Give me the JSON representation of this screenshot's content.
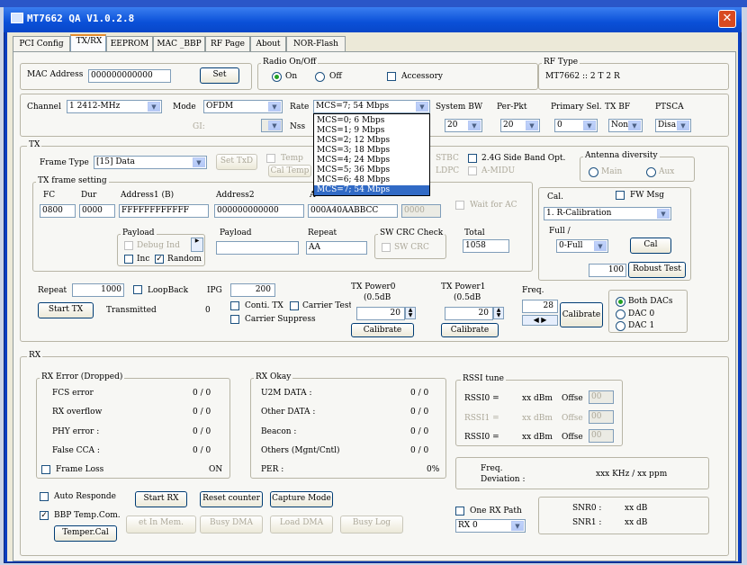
{
  "window": {
    "title": "MT7662 QA V1.0.2.8"
  },
  "tabs": [
    "PCI Config",
    "TX/RX",
    "EEPROM",
    "MAC _BBP",
    "RF Page",
    "About",
    "NOR-Flash"
  ],
  "top": {
    "mac_label": "MAC Address",
    "mac_value": "000000000000",
    "set": "Set",
    "radio_label": "Radio On/Off",
    "on": "On",
    "off": "Off",
    "accessory": "Accessory",
    "rftype_label": "RF Type",
    "rftype_value": "MT7662 :: 2 T 2 R"
  },
  "row2": {
    "channel_label": "Channel",
    "channel_value": "1  2412-MHz",
    "mode_label": "Mode",
    "mode_value": "OFDM",
    "gi": "GI:",
    "rate_label": "Rate",
    "rate_value": "MCS=7;  54 Mbps",
    "nss": "Nss",
    "sysbw_label": "System BW",
    "sysbw_value": "20",
    "perpkt_label": "Per-Pkt",
    "perpkt_value": "20",
    "primary_label": "Primary Sel.",
    "primary_value": "0",
    "txbf_label": "TX BF",
    "txbf_value": "Non",
    "ptsca_label": "PTSCA",
    "ptsca_value": "Disa"
  },
  "rate_options": [
    "MCS=0;  6 Mbps",
    "MCS=1;  9 Mbps",
    "MCS=2;  12 Mbps",
    "MCS=3;  18 Mbps",
    "MCS=4;  24 Mbps",
    "MCS=5;  36 Mbps",
    "MCS=6;  48 Mbps",
    "MCS=7;  54 Mbps"
  ],
  "tx": {
    "label": "TX",
    "frame_type_label": "Frame Type",
    "frame_type_value": "[15] Data",
    "set_txd": "Set TxD",
    "temp": "Temp",
    "cal_temp": "Cal Temp",
    "stbc": "STBC",
    "ldpc": "A-MIDU",
    "side_band": "2.4G Side Band Opt.",
    "antenna_label": "Antenna diversity",
    "main": "Main",
    "aux": "Aux",
    "frame_setting": "TX frame setting",
    "fc_label": "FC",
    "fc_value": "0800",
    "dur_label": "Dur",
    "dur_value": "0000",
    "addr1_label": "Address1 (B)",
    "addr1_value": "FFFFFFFFFFFF",
    "addr2_label": "Address2",
    "addr2_value": "000000000000",
    "addr3_label": "A",
    "addr3_value": "000A40AABBCC",
    "seq_value": "0000",
    "wait_ac": "Wait for AC",
    "payload_label": "Payload",
    "debug_ind": "Debug Ind",
    "inc": "Inc",
    "random": "Random",
    "payload2_label": "Payload",
    "repeat_label": "Repeat",
    "repeat_value": "AA",
    "sw_crc_label": "SW CRC Check",
    "sw_crc": "SW CRC",
    "total_label": "Total",
    "total_value": "1058",
    "cal_label": "Cal.",
    "fw_msg": "FW Msg",
    "cal_value": "1. R-Calibration",
    "full_label": "Full /",
    "full_value": "0-Full",
    "cal_btn": "Cal",
    "robust_value": "100",
    "robust_btn": "Robust Test",
    "repeat2_label": "Repeat",
    "repeat2_value": "1000",
    "loopback": "LoopBack",
    "ipg_label": "IPG",
    "ipg_value": "200",
    "start_tx": "Start TX",
    "transmitted_label": "Transmitted",
    "transmitted_value": "0",
    "conti": "Conti. TX",
    "carrier": "Carrier Test",
    "carrier_sup": "Carrier Suppress",
    "power0_label": "TX Power0",
    "power0_unit": "(0.5dB",
    "power0_value": "20",
    "calibrate0": "Calibrate",
    "power1_label": "TX Power1",
    "power1_unit": "(0.5dB",
    "power1_value": "20",
    "calibrate1": "Calibrate",
    "freq_label": "Freq.",
    "freq_value": "28",
    "calibrate2": "Calibrate",
    "both_dacs": "Both DACs",
    "dac0": "DAC 0",
    "dac1": "DAC 1"
  },
  "rx": {
    "label": "RX",
    "error_label": "RX Error (Dropped)",
    "fcs": "FCS error",
    "fcs_v": "0 / 0",
    "overflow": "RX overflow",
    "overflow_v": "0 / 0",
    "phy": "PHY error :",
    "phy_v": "0 / 0",
    "false_cca": "False CCA :",
    "false_cca_v": "0 / 0",
    "frame_loss": "Frame Loss",
    "frame_loss_v": "ON",
    "okay_label": "RX Okay",
    "u2m": "U2M DATA :",
    "u2m_v": "0 / 0",
    "other": "Other DATA :",
    "other_v": "0 / 0",
    "beacon": "Beacon :",
    "beacon_v": "0 / 0",
    "others": "Others (Mgnt/Cntl)",
    "others_v": "0 / 0",
    "per": "PER :",
    "per_v": "0%",
    "rssi_label": "RSSI tune",
    "rssi0": "RSSI0 =",
    "rssi1": "RSSI1 =",
    "rssi2": "RSSI0 =",
    "dbm": "xx dBm",
    "offset": "Offse",
    "off0": "00",
    "off1": "00",
    "off2": "00",
    "freq_dev_label": "Freq.",
    "freq_dev_label2": "Deviation :",
    "freq_dev_value": "xxx KHz / xx ppm",
    "auto_respond": "Auto Responde",
    "start_rx": "Start RX",
    "reset_counter": "Reset counter",
    "capture_mode": "Capture Mode",
    "bbp_temp": "BBP Temp.Com.",
    "get_in_mem": "et In Mem.",
    "busy_dma": "Busy DMA",
    "load_dma": "Load DMA",
    "busy_log": "Busy Log",
    "temper_cal": "Temper.Cal",
    "one_rx_path": "One RX Path",
    "rx_path_value": "RX 0",
    "snr0": "SNR0 :",
    "snr1": "SNR1 :",
    "snr_value": "xx dB"
  }
}
